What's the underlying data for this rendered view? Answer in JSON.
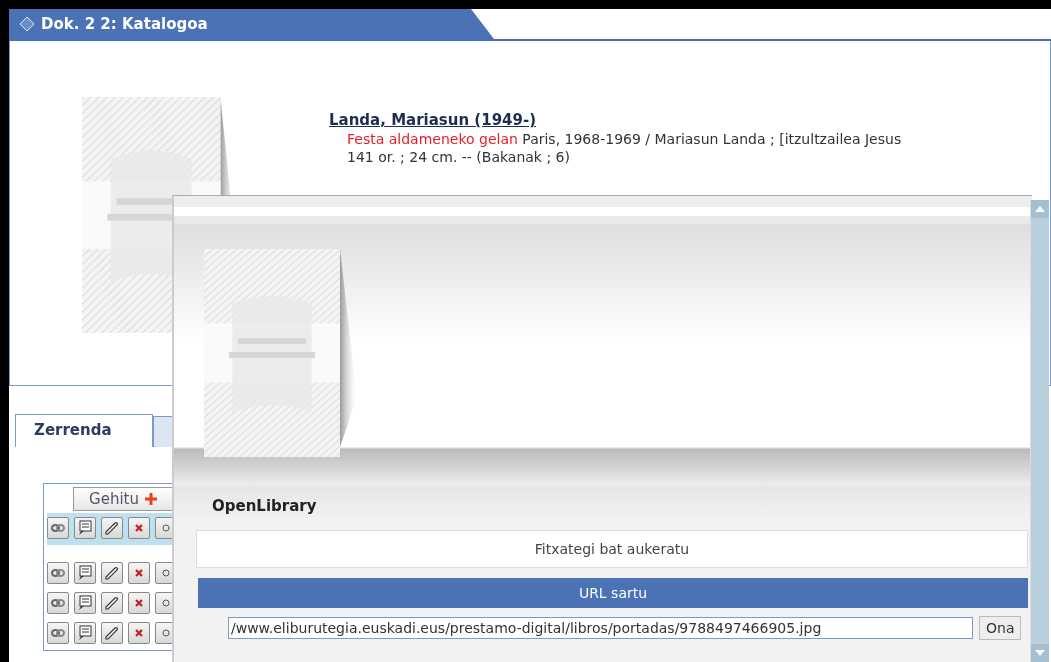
{
  "window": {
    "title": "Dok. 2 2: Katalogoa"
  },
  "record": {
    "heading": "Landa, Mariasun (1949-)",
    "title": "Festa aldameneko gelan",
    "description": "Paris, 1968-1969 / Mariasun Landa ; [itzultzailea Jesus",
    "extent": "141 or. ; 24 cm. -- (Bakanak ; 6)"
  },
  "lower_tabs": [
    {
      "label": "Zerrenda",
      "selected": true
    },
    {
      "selected": false
    }
  ],
  "list": {
    "add_button": "Gehitu",
    "rows": [
      {
        "selected": true
      },
      {
        "selected": false
      },
      {
        "selected": false
      },
      {
        "selected": false
      }
    ]
  },
  "dialog": {
    "section_title": "OpenLibrary",
    "tabs": [
      {
        "label": "Fitxategi bat aukeratu",
        "selected": false
      },
      {
        "label": "URL sartu",
        "selected": true
      }
    ],
    "url_field": {
      "value": "/www.eliburutegia.euskadi.eus/prestamo-digital/libros/portadas/9788497466905.jpg"
    },
    "ok_button": "Ona"
  }
}
